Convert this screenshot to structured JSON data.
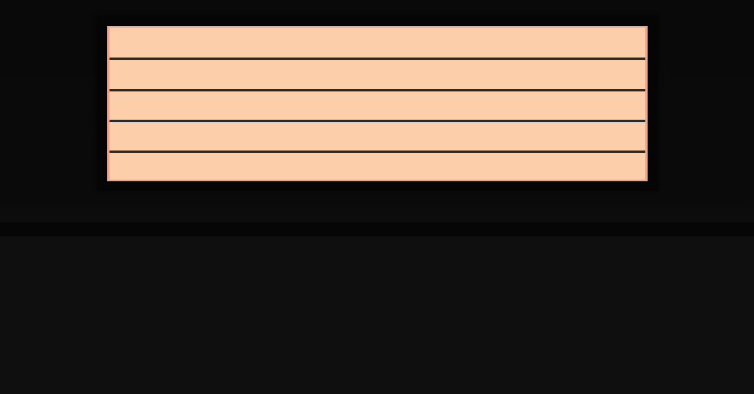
{
  "theme": {
    "page_background": "#0f0f0f",
    "top_background": "#0a0a0a",
    "frame_background": "#050505",
    "stack_fill": "#fcceaa",
    "stack_border": "#e9a58d",
    "divider_color": "#2a2a2a",
    "separator_band": "#060606"
  },
  "stack": {
    "rows": [
      {},
      {},
      {},
      {},
      {}
    ]
  }
}
